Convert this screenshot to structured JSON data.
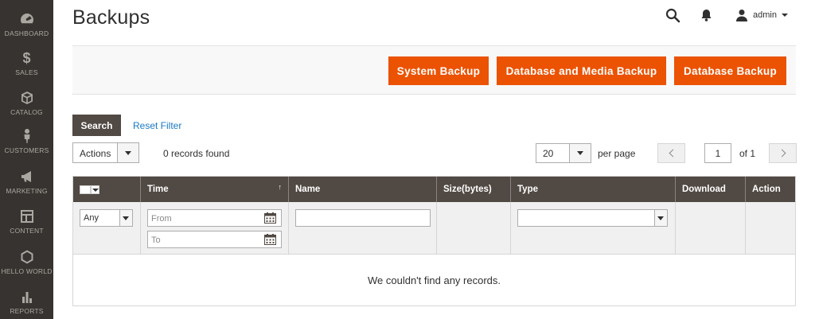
{
  "sidebar": {
    "items": [
      {
        "label": "DASHBOARD",
        "icon": "dashboard-icon"
      },
      {
        "label": "SALES",
        "icon": "dollar-icon"
      },
      {
        "label": "CATALOG",
        "icon": "box-icon"
      },
      {
        "label": "CUSTOMERS",
        "icon": "person-icon"
      },
      {
        "label": "MARKETING",
        "icon": "megaphone-icon"
      },
      {
        "label": "CONTENT",
        "icon": "layout-icon"
      },
      {
        "label": "HELLO WORLD",
        "icon": "hexagon-icon"
      },
      {
        "label": "REPORTS",
        "icon": "bar-chart-icon"
      }
    ]
  },
  "header": {
    "title": "Backups",
    "user": "admin"
  },
  "action_buttons": {
    "system_backup": "System Backup",
    "db_media_backup": "Database and Media Backup",
    "db_backup": "Database Backup"
  },
  "search": {
    "search_label": "Search",
    "reset_label": "Reset Filter"
  },
  "toolbar": {
    "actions_label": "Actions",
    "records_found": "0 records found",
    "per_page_value": "20",
    "per_page_label": "per page",
    "current_page": "1",
    "page_of": "of 1"
  },
  "grid": {
    "columns": [
      "Time",
      "Name",
      "Size(bytes)",
      "Type",
      "Download",
      "Action"
    ],
    "sort_indicator": "↑",
    "filters": {
      "any": "Any",
      "from_placeholder": "From",
      "to_placeholder": "To"
    },
    "empty_message": "We couldn't find any records."
  },
  "colors": {
    "sidebar_bg": "#373330",
    "accent": "#eb5202",
    "grid_header_bg": "#514943",
    "link": "#1979c3"
  }
}
